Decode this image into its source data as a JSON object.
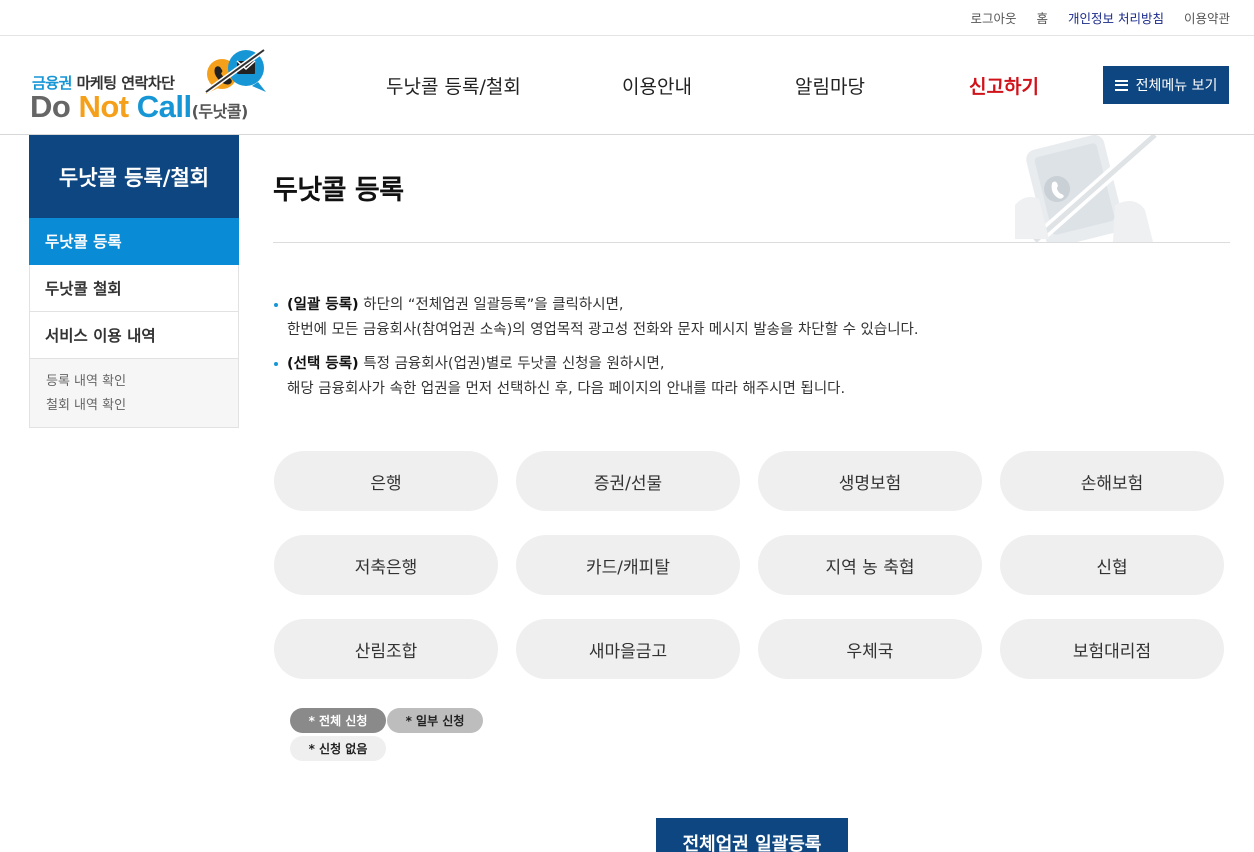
{
  "util": {
    "logout": "로그아웃",
    "home": "홈",
    "privacy": "개인정보 처리방침",
    "terms": "이용약관"
  },
  "logo": {
    "top_blue": "금융권",
    "top_rest": " 마케팅 연락차단",
    "do": "Do ",
    "not": "Not ",
    "call": "Call",
    "sub": "(두낫콜)"
  },
  "gnb": [
    "두낫콜 등록/철회",
    "이용안내",
    "알림마당",
    "신고하기"
  ],
  "all_menu_label": "전체메뉴 보기",
  "lnb": {
    "title": "두낫콜 등록/철회",
    "items": [
      "두낫콜 등록",
      "두낫콜 철회",
      "서비스 이용 내역"
    ],
    "sub_items": [
      "등록 내역 확인",
      "철회 내역 확인"
    ]
  },
  "page_title": "두낫콜 등록",
  "desc": [
    {
      "bold": "(일괄 등록)",
      "line1": " 하단의 “전체업권 일괄등록”을 클릭하시면,",
      "line2": "한번에 모든 금융회사(참여업권 소속)의 영업목적 광고성 전화와 문자 메시지 발송을 차단할 수 있습니다."
    },
    {
      "bold": "(선택 등록)",
      "line1": " 특정 금융회사(업권)별로 두낫콜 신청을 원하시면,",
      "line2": "해당 금융회사가 속한 업권을 먼저 선택하신 후, 다음 페이지의 안내를 따라 해주시면 됩니다."
    }
  ],
  "categories": [
    "은행",
    "증권/선물",
    "생명보험",
    "손해보험",
    "저축은행",
    "카드/캐피탈",
    "지역 농 축협",
    "신협",
    "산림조합",
    "새마을금고",
    "우체국",
    "보험대리점"
  ],
  "legend": [
    "* 전체 신청",
    "* 일부 신청",
    "* 신청 없음"
  ],
  "bulk_button": "전체업권 일괄등록",
  "colors": {
    "navy": "#0d4680",
    "sky": "#0a8bd6",
    "red": "#d0121a",
    "orange": "#f5a01a"
  }
}
